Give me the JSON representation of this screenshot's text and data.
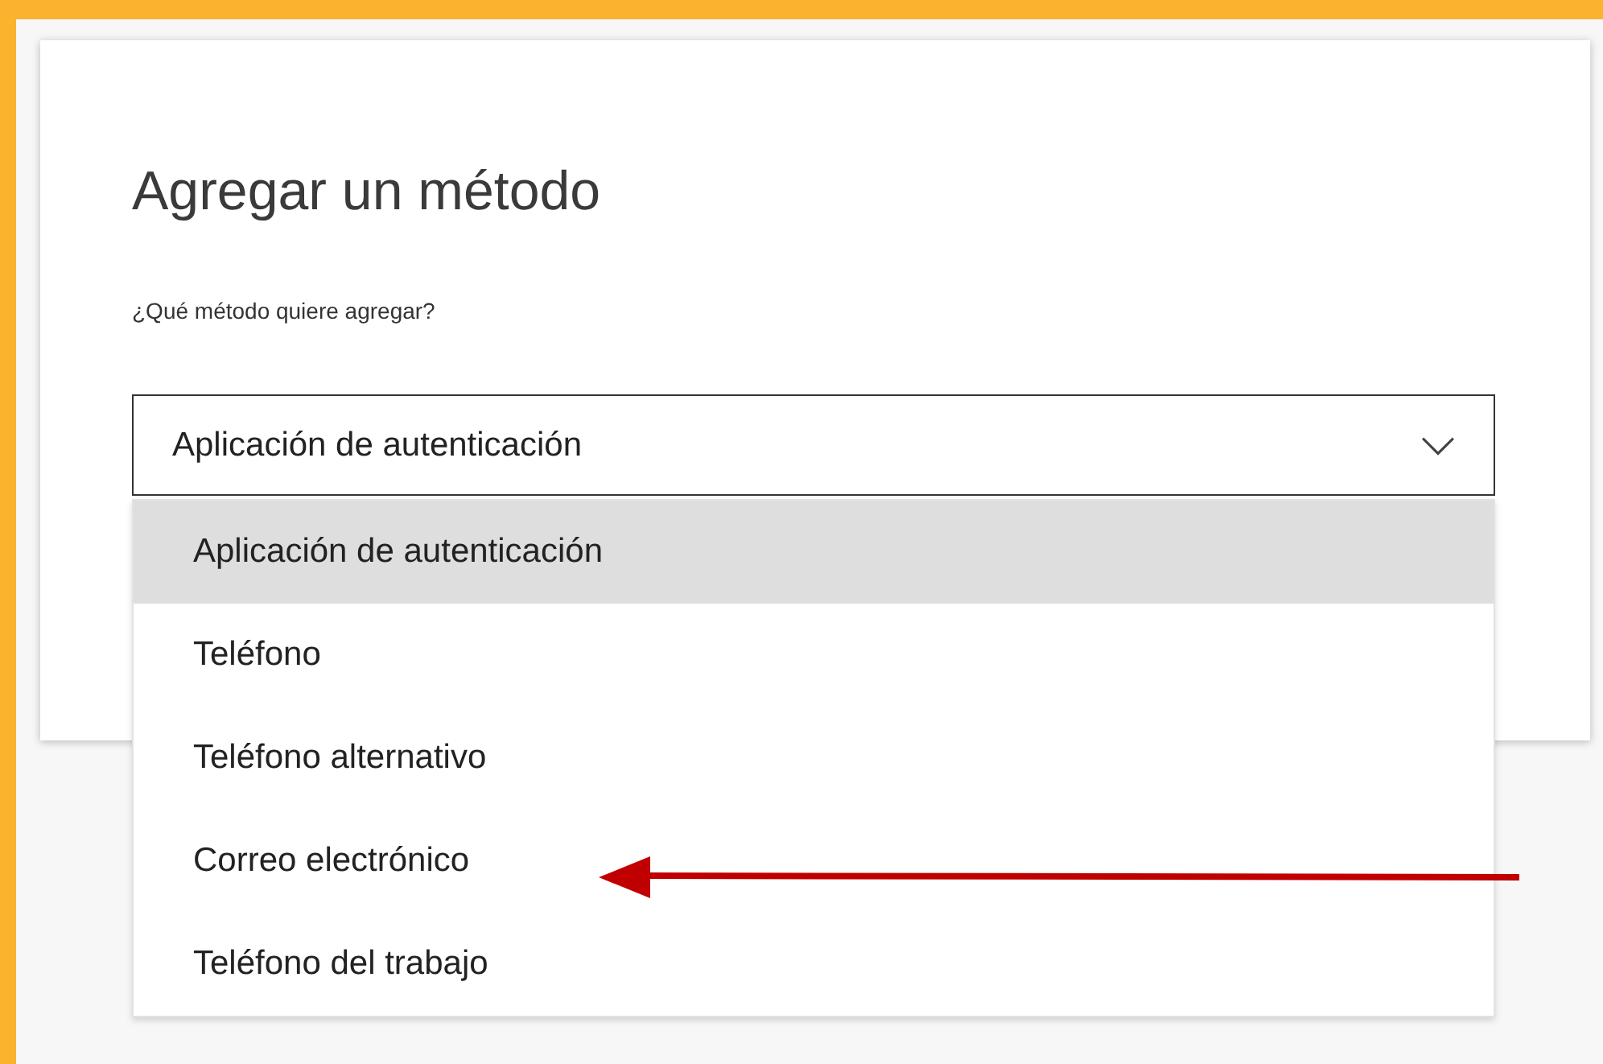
{
  "dialog": {
    "title": "Agregar un método",
    "question": "¿Qué método quiere agregar?"
  },
  "method_select": {
    "value": "Aplicación de autenticación",
    "expanded": true,
    "options": [
      {
        "label": "Aplicación de autenticación",
        "selected": true
      },
      {
        "label": "Teléfono",
        "selected": false
      },
      {
        "label": "Teléfono alternativo",
        "selected": false
      },
      {
        "label": "Correo electrónico",
        "selected": false
      },
      {
        "label": "Teléfono del trabajo",
        "selected": false
      }
    ]
  }
}
